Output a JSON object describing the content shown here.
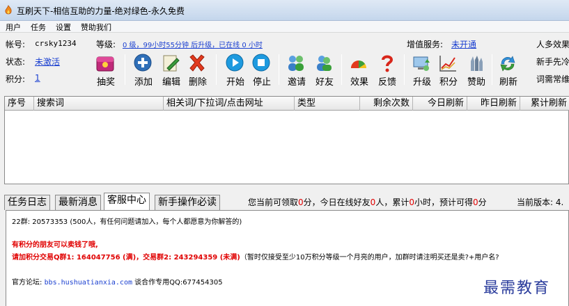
{
  "window": {
    "title": "互刷天下-相信互助的力量-绝对绿色-永久免费"
  },
  "menu": [
    "用户",
    "任务",
    "设置",
    "赞助我们"
  ],
  "account": {
    "account_label": "帐号:",
    "account_value": "crsky1234",
    "status_label": "状态:",
    "status_value": "未激活",
    "points_label": "积分:",
    "points_value": "1",
    "level_label": "等级:",
    "level_value": "0 级，99小时55分钟 后升级，已在线 0 小时",
    "vas_label": "增值服务:",
    "vas_value": "未开通",
    "right_1": "人多效果",
    "right_2": "新手先冷",
    "right_3": "词需常维"
  },
  "toolbar": [
    {
      "label": "抽奖",
      "icon": "lottery-box-icon"
    },
    {
      "label": "添加",
      "icon": "add-icon"
    },
    {
      "label": "编辑",
      "icon": "edit-icon"
    },
    {
      "label": "删除",
      "icon": "delete-icon"
    },
    {
      "label": "开始",
      "icon": "play-icon"
    },
    {
      "label": "停止",
      "icon": "stop-icon"
    },
    {
      "label": "邀请",
      "icon": "invite-icon"
    },
    {
      "label": "好友",
      "icon": "friends-icon"
    },
    {
      "label": "效果",
      "icon": "effect-icon"
    },
    {
      "label": "反馈",
      "icon": "feedback-icon"
    },
    {
      "label": "升级",
      "icon": "upgrade-icon"
    },
    {
      "label": "积分",
      "icon": "points-chart-icon"
    },
    {
      "label": "赞助",
      "icon": "sponsor-icon"
    },
    {
      "label": "刷新",
      "icon": "refresh-icon"
    }
  ],
  "table": {
    "columns": [
      "序号",
      "搜索词",
      "相关词/下拉词/点击网址",
      "类型",
      "剩余次数",
      "今日刷新",
      "昨日刷新",
      "累计刷新"
    ]
  },
  "tabs": [
    "任务日志",
    "最新消息",
    "客服中心",
    "新手操作必读"
  ],
  "status": {
    "p1": "您当前可领取",
    "v1": "0",
    "p2": "分，今日在线好友",
    "v2": "0",
    "p3": "人，累计",
    "v3": "0",
    "p4": "小时，预计可得",
    "v4": "0",
    "p5": "分",
    "version": "当前版本: 4."
  },
  "log": {
    "line1": "22群: 20573353 (500人，有任何问题请加入，每个人都愿意为你解答的)",
    "line2": "有积分的朋友可以卖钱了哦,",
    "line3a": "请加积分交易Q群1: 164047756 (满)，交易群2: 243294359 (未满)",
    "line3b": "（暂时仅接受至少10万积分等级一个月亮的用户，加群时请注明买还是卖?+用户名?",
    "line4a": "官方论坛: ",
    "line4b": "bbs.hushuatianxia.com",
    "line4c": " 谈合作专用QQ:677454305"
  },
  "watermark": "最需教育",
  "colors": {
    "link": "#1a3fd0",
    "warning": "#e00000",
    "title_bar": "#c4d6ec"
  }
}
